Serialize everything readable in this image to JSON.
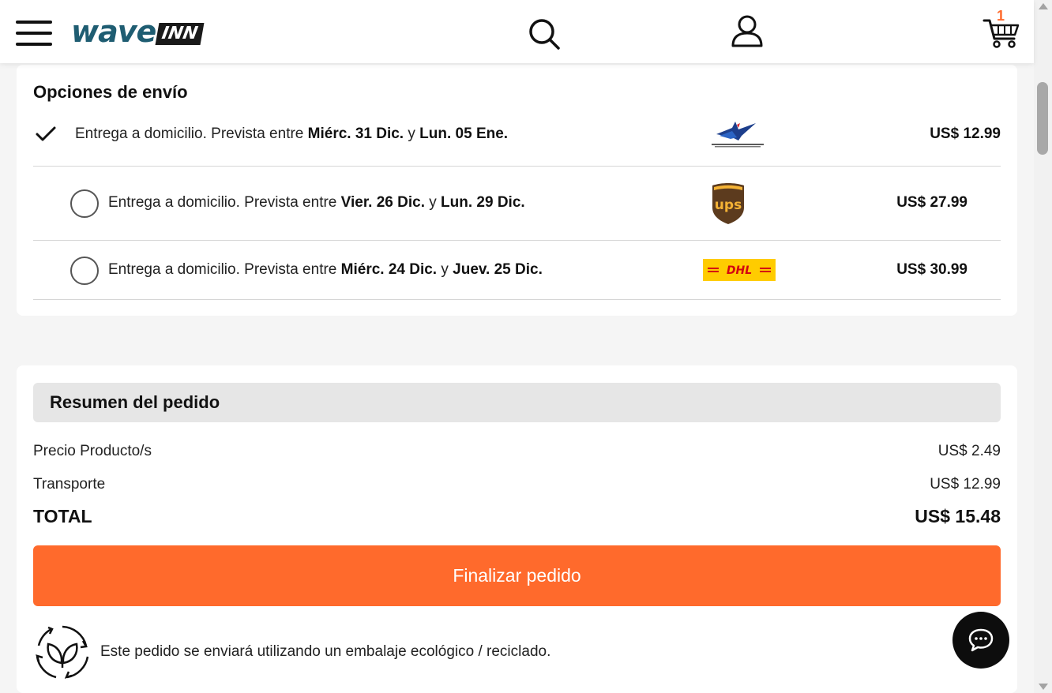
{
  "header": {
    "logo_wave": "wave",
    "logo_inn": "INN",
    "cart_count": "1",
    "icons": [
      "menu-icon",
      "search-icon",
      "user-icon",
      "cart-icon"
    ]
  },
  "shipping": {
    "title": "Opciones de envío",
    "options": [
      {
        "prefix": "Entrega a domicilio. Prevista entre ",
        "from": "Miérc. 31 Dic.",
        "joiner": " y ",
        "to": "Lun. 05 Ene.",
        "carrier_icon": "correos-del-ecuador-logo",
        "price": "US$ 12.99",
        "selected": true
      },
      {
        "prefix": "Entrega a domicilio. Prevista entre ",
        "from": "Vier. 26 Dic.",
        "joiner": " y ",
        "to": "Lun. 29 Dic.",
        "carrier_icon": "ups-logo",
        "price": "US$ 27.99",
        "selected": false
      },
      {
        "prefix": "Entrega a domicilio. Prevista entre ",
        "from": "Miérc. 24 Dic.",
        "joiner": " y ",
        "to": "Juev. 25 Dic.",
        "carrier_icon": "dhl-logo",
        "price": "US$ 30.99",
        "selected": false
      }
    ]
  },
  "summary": {
    "title": "Resumen del pedido",
    "product_label": "Precio Producto/s",
    "product_value": "US$ 2.49",
    "transport_label": "Transporte",
    "transport_value": "US$ 12.99",
    "total_label": "TOTAL",
    "total_value": "US$ 15.48",
    "finalize_label": "Finalizar pedido",
    "eco_text": "Este pedido se enviará utilizando un embalaje ecológico / reciclado."
  },
  "colors": {
    "accent": "#ff6a2c",
    "logo_blue": "#1f5d72",
    "ups_brown": "#5c3b1e",
    "ups_gold": "#f5b335",
    "dhl_yellow": "#ffcc00",
    "dhl_red": "#d40511"
  }
}
